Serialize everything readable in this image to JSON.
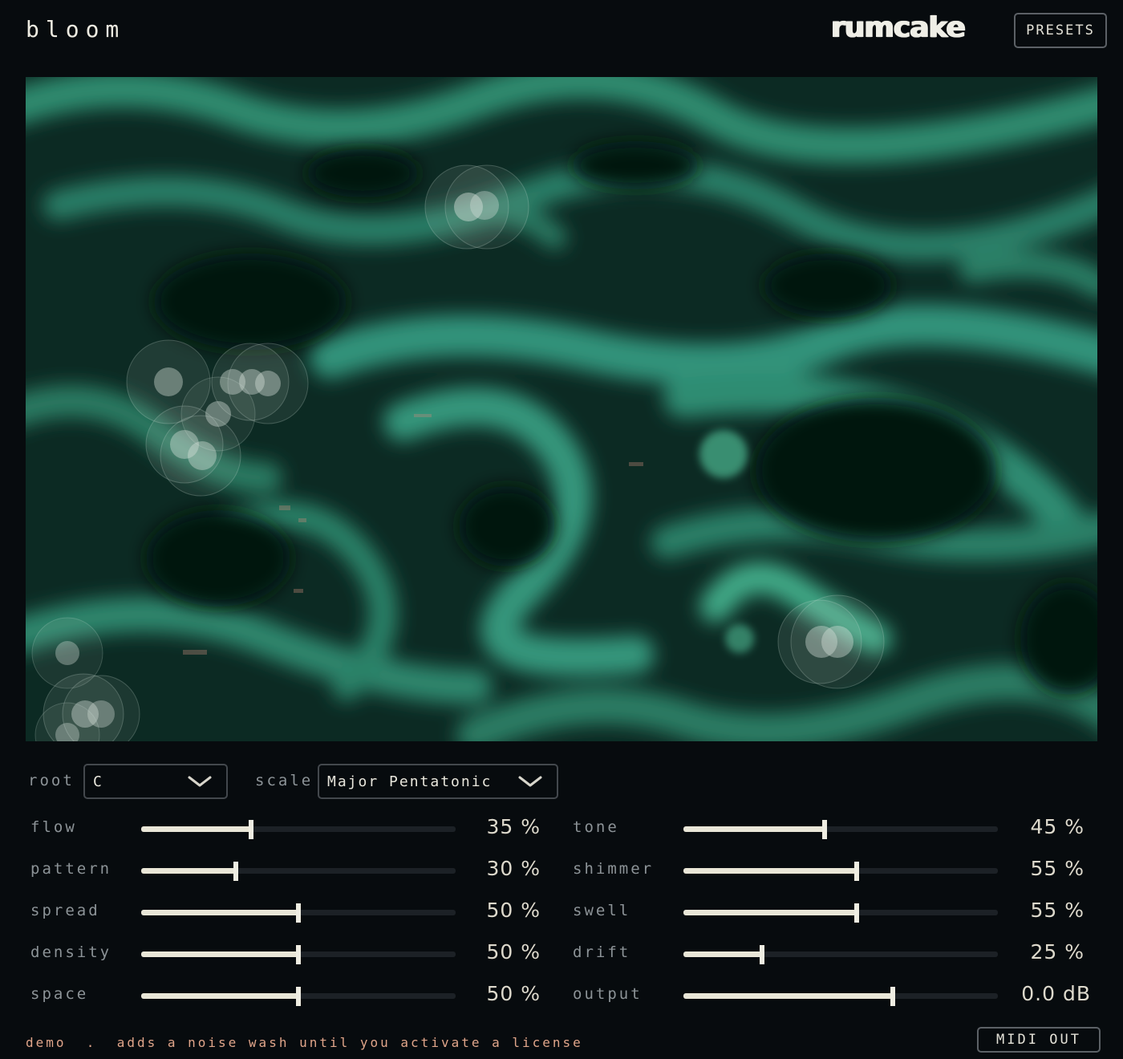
{
  "header": {
    "app_title": "bloom",
    "brand": "rumcake",
    "presets_label": "PRESETS"
  },
  "selectors": {
    "root_label": "root",
    "root_value": "C",
    "scale_label": "scale",
    "scale_value": "Major Pentatonic"
  },
  "params_left": [
    {
      "label": "flow",
      "value": "35 %",
      "level": 0.35
    },
    {
      "label": "pattern",
      "value": "30 %",
      "level": 0.3
    },
    {
      "label": "spread",
      "value": "50 %",
      "level": 0.5
    },
    {
      "label": "density",
      "value": "50 %",
      "level": 0.5
    },
    {
      "label": "space",
      "value": "50 %",
      "level": 0.5
    }
  ],
  "params_right": [
    {
      "label": "tone",
      "value": "45 %",
      "level": 0.45
    },
    {
      "label": "shimmer",
      "value": "55 %",
      "level": 0.55
    },
    {
      "label": "swell",
      "value": "55 %",
      "level": 0.55
    },
    {
      "label": "drift",
      "value": "25 %",
      "level": 0.25
    },
    {
      "label": "output",
      "value": "0.0 dB",
      "level": 0.667
    }
  ],
  "footer": {
    "demo_text": "demo  .  adds a noise wash until you activate a license",
    "midi_label": "MIDI OUT"
  },
  "colors": {
    "background": "#070b0e",
    "accent": "#e9e6d7",
    "visualizer": "#3a9c7e",
    "demo": "#e0a58a"
  }
}
